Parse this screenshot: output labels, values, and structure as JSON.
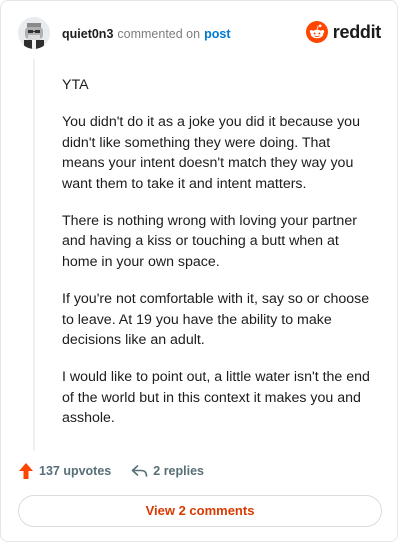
{
  "header": {
    "username": "quiet0n3",
    "action_text": "commented on",
    "post_link": "post",
    "brand_name": "reddit"
  },
  "comment": {
    "paragraphs": [
      "YTA",
      "You didn't do it as a joke you did it because you didn't like something they were doing. That means your intent doesn't match they way you want them to take it and intent matters.",
      "There is nothing wrong with loving your partner and having a kiss or touching a butt when at home in your own space.",
      "If you're not comfortable with it, say so or choose to leave. At 19 you have the ability to make decisions like an adult.",
      "I would like to point out, a little water isn't the end of the world but in this context it makes you and asshole."
    ]
  },
  "actions": {
    "upvotes_label": "137 upvotes",
    "replies_label": "2 replies"
  },
  "view_comments_label": "View 2 comments",
  "icons": {
    "avatar": "avatar-icon",
    "brand": "reddit-logo-icon",
    "upvote": "upvote-arrow-icon",
    "reply": "reply-arrow-icon"
  },
  "colors": {
    "brand_orange": "#ff4500",
    "link_blue": "#0079d3",
    "button_text": "#d93a00",
    "muted_text": "#576f76"
  }
}
